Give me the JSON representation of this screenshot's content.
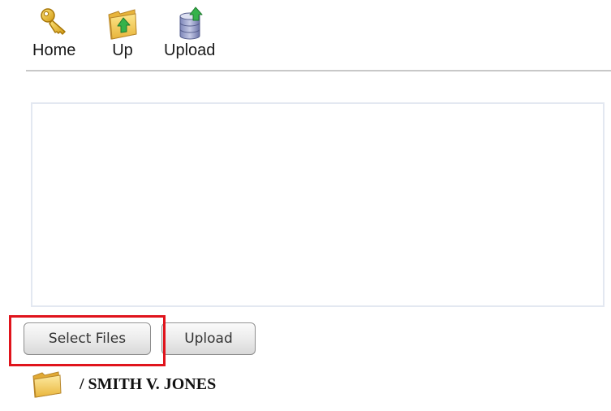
{
  "toolbar": {
    "home_label": "Home",
    "up_label": "Up",
    "upload_label": "Upload",
    "icons": {
      "home": "key-icon",
      "up": "folder-up-icon",
      "upload": "database-upload-icon"
    }
  },
  "file_list": {
    "items": []
  },
  "actions": {
    "select_files_label": "Select Files",
    "upload_label": "Upload"
  },
  "annotation": {
    "highlight_color": "#e0141c"
  },
  "path": {
    "icon": "folder-icon",
    "text": "/ SMITH V. JONES"
  }
}
